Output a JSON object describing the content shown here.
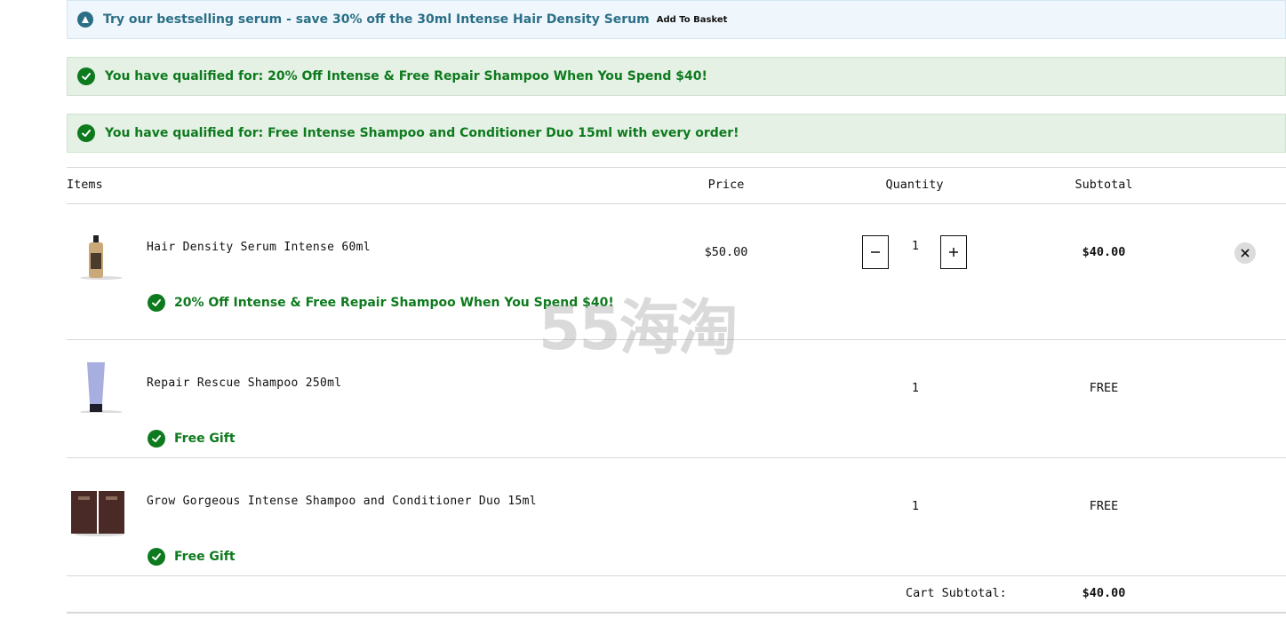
{
  "banners": {
    "upsell_text": "Try our bestselling serum - save 30% off the 30ml Intense Hair Density Serum",
    "add_to_basket": "Add To Basket",
    "qualified_1": "You have qualified for: 20% Off Intense & Free Repair Shampoo When You Spend $40!",
    "qualified_2": "You have qualified for: Free Intense Shampoo and Conditioner Duo 15ml with every order!"
  },
  "table": {
    "headers": {
      "items": "Items",
      "price": "Price",
      "quantity": "Quantity",
      "subtotal": "Subtotal"
    }
  },
  "items": [
    {
      "name": "Hair Density Serum Intense 60ml",
      "price": "$50.00",
      "quantity": "1",
      "subtotal": "$40.00",
      "promo": "20% Off Intense & Free Repair Shampoo When You Spend $40!",
      "minus_icon": "minus-icon",
      "plus_icon": "plus-icon",
      "remove_icon": "close-icon"
    },
    {
      "name": "Repair Rescue Shampoo 250ml",
      "quantity": "1",
      "subtotal": "FREE",
      "promo": "Free Gift"
    },
    {
      "name": "Grow Gorgeous Intense Shampoo and Conditioner Duo 15ml",
      "quantity": "1",
      "subtotal": "FREE",
      "promo": "Free Gift"
    }
  ],
  "summary": {
    "cart_subtotal_label": "Cart Subtotal:",
    "cart_subtotal_value": "$40.00"
  },
  "watermark": "55海淘",
  "colors": {
    "success_green": "#0e7a1e",
    "info_teal": "#2b6f87",
    "success_bg": "#e6f1e6",
    "info_bg": "#f0f7fc"
  }
}
